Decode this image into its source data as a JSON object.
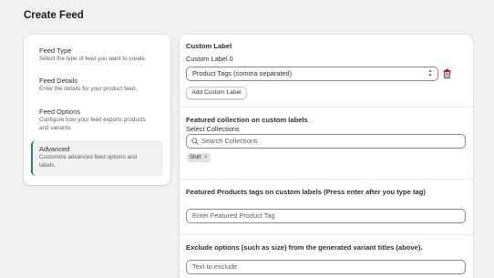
{
  "page_title": "Create Feed",
  "steps": [
    {
      "title": "Feed Type",
      "desc_lines": [
        "Select the type of feed you want to create."
      ]
    },
    {
      "title": "Feed Details",
      "desc_lines": [
        "Enter the details for your product feed."
      ]
    },
    {
      "title": "Feed Options",
      "desc_lines": [
        "Configure how your feed exports products",
        "and variants."
      ]
    },
    {
      "title": "Advanced",
      "desc_lines": [
        "Customize advanced feed options and",
        "labels."
      ],
      "active": true
    }
  ],
  "custom_label": {
    "title": "Custom Label",
    "field_label": "Custom Label 0",
    "selected_value": "Product Tags (comma separated)",
    "delete_icon": "trash-icon",
    "add_button": "Add Custom Label"
  },
  "featured_collection": {
    "title": "Featured collection on custom labels",
    "field_label": "Select Collections",
    "search_placeholder": "Search Collections",
    "search_icon": "search-icon",
    "tags": [
      "Shirt"
    ]
  },
  "featured_tags": {
    "title": "Featured Products tags on custom labels (Press enter after you type tag)",
    "placeholder": "Enter Featured Product Tag"
  },
  "exclude_options": {
    "title": "Exclude options (such as size) from the generated variant titles (above).",
    "placeholder": "Text to exclude"
  },
  "colors": {
    "page_bg": "#f1f1f1",
    "card_bg": "#ffffff",
    "active_accent": "#29845a",
    "delete_icon": "#c70a24"
  }
}
